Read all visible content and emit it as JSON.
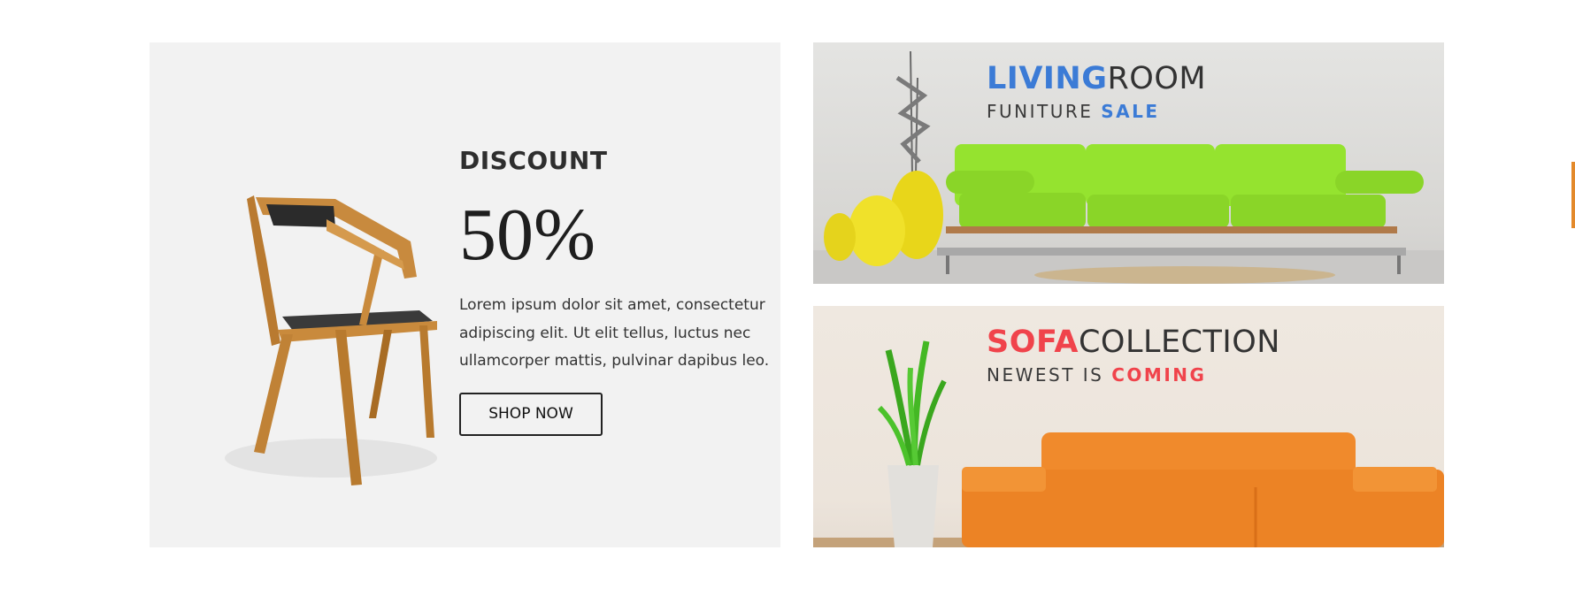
{
  "promo": {
    "title": "DISCOUNT",
    "value": "50%",
    "body": "Lorem ipsum dolor sit amet, consectetur adipiscing elit. Ut elit tellus, luctus nec ullamcorper mattis, pulvinar dapibus leo.",
    "button_label": "SHOP NOW"
  },
  "living_room_banner": {
    "headline_strong": "LIVING",
    "headline_rest": "ROOM",
    "subline_text": "FUNITURE ",
    "subline_accent": "SALE",
    "accent_color": "#3b7bd6",
    "sofa_color": "#8fdf2a"
  },
  "sofa_banner": {
    "headline_strong": "SOFA",
    "headline_rest": "COLLECTION",
    "subline_text": "NEWEST IS ",
    "subline_accent": "COMING",
    "accent_color": "#f0434b",
    "sofa_color": "#f08a2c"
  },
  "icons": {
    "chair": "wooden-chair-illustration",
    "vases": "yellow-vases-illustration",
    "plant": "potted-plant-illustration",
    "edge_tab": "side-tab"
  }
}
